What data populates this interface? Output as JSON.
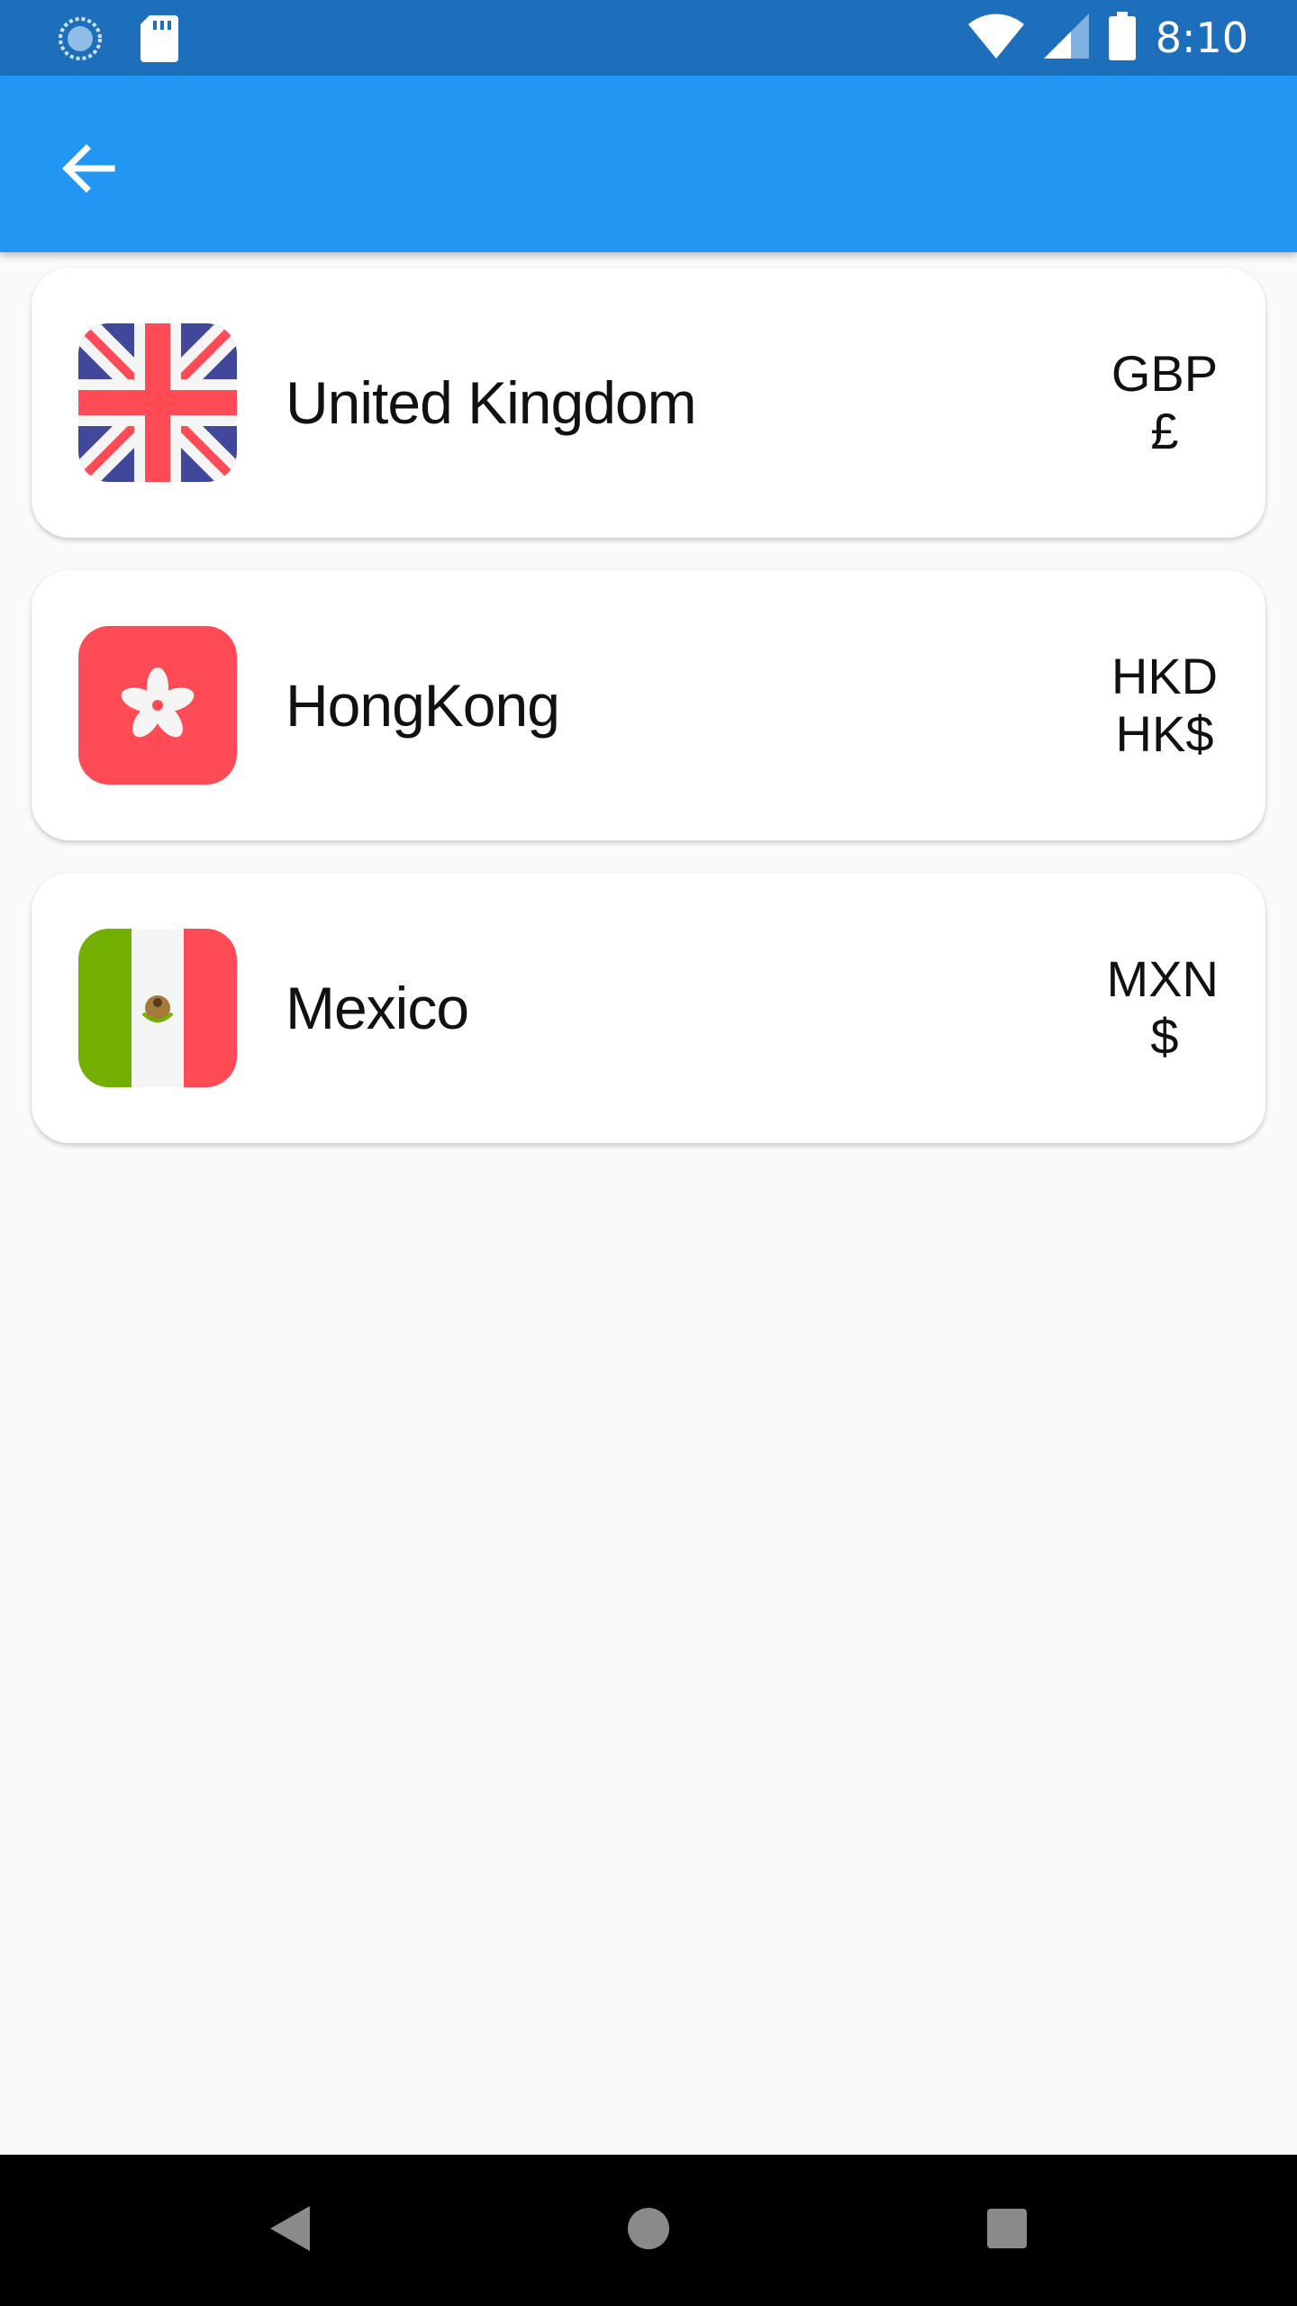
{
  "status_bar": {
    "time": "8:10",
    "icons": [
      "sync-icon",
      "sd-card-icon",
      "wifi-icon",
      "signal-icon",
      "battery-icon"
    ]
  },
  "app_bar": {
    "back_icon": "arrow-back-icon",
    "color": "#2196f3"
  },
  "countries": [
    {
      "name": "United Kingdom",
      "code": "GBP",
      "symbol": "£",
      "flag": "uk-flag-icon"
    },
    {
      "name": "HongKong",
      "code": "HKD",
      "symbol": "HK$",
      "flag": "hongkong-flag-icon"
    },
    {
      "name": "Mexico",
      "code": "MXN",
      "symbol": "$",
      "flag": "mexico-flag-icon"
    }
  ],
  "nav_bar": {
    "icons": [
      "nav-back-icon",
      "nav-home-icon",
      "nav-recents-icon"
    ]
  },
  "colors": {
    "status_bar": "#1e6fbb",
    "app_bar": "#2196f3",
    "background": "#fafafa",
    "flag_red": "#ff4b55",
    "flag_blue": "#41479b",
    "flag_green": "#73af00"
  }
}
